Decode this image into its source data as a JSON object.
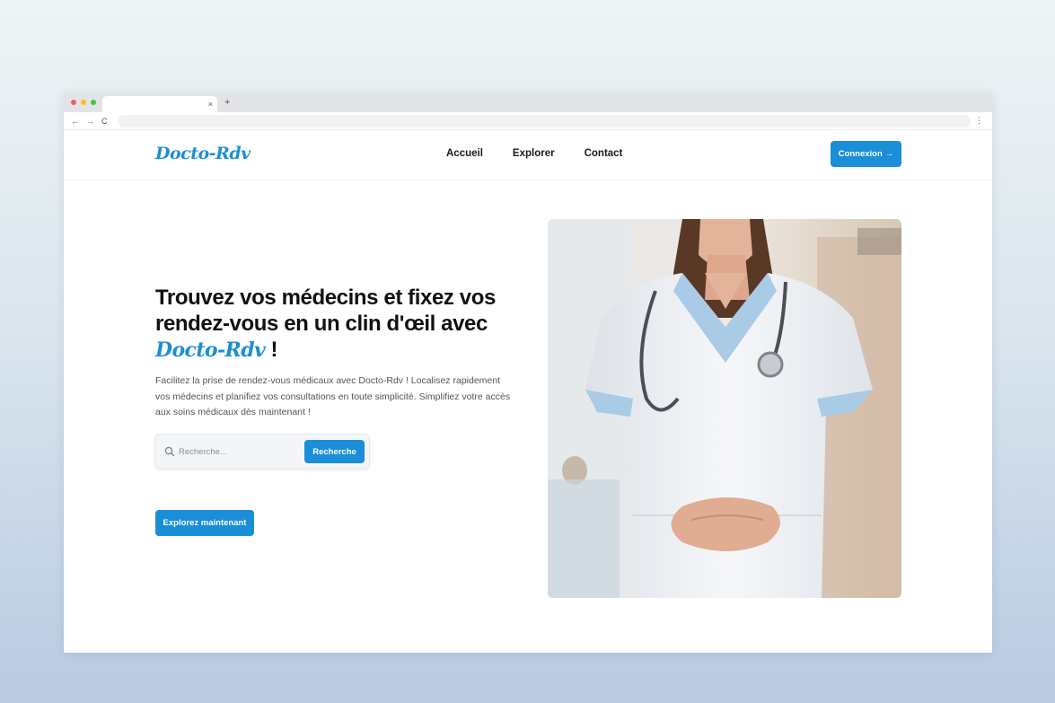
{
  "browser": {
    "tab_close": "×",
    "new_tab": "+",
    "nav_back": "←",
    "nav_forward": "→",
    "nav_reload": "C",
    "menu": "⋮"
  },
  "site": {
    "logo": "Docto-Rdv",
    "nav": {
      "home": "Accueil",
      "explore": "Explorer",
      "contact": "Contact"
    },
    "login_label": "Connexion",
    "login_arrow": "→"
  },
  "hero": {
    "title_part1": "Trouvez vos médecins et fixez vos rendez-vous en un clin d'œil avec ",
    "title_brand": "Docto-Rdv",
    "title_end": " !",
    "description": "Facilitez la prise de rendez-vous médicaux avec Docto-Rdv ! Localisez rapidement vos médecins et planifiez vos consultations en toute simplicité. Simplifiez votre accès aux soins médicaux dès maintenant !",
    "search_placeholder": "Recherche...",
    "search_button": "Recherche",
    "cta": "Explorez maintenant",
    "image_icon": "doctor-photo"
  },
  "colors": {
    "accent": "#1a8fd8",
    "brand": "#1d8ed4"
  }
}
